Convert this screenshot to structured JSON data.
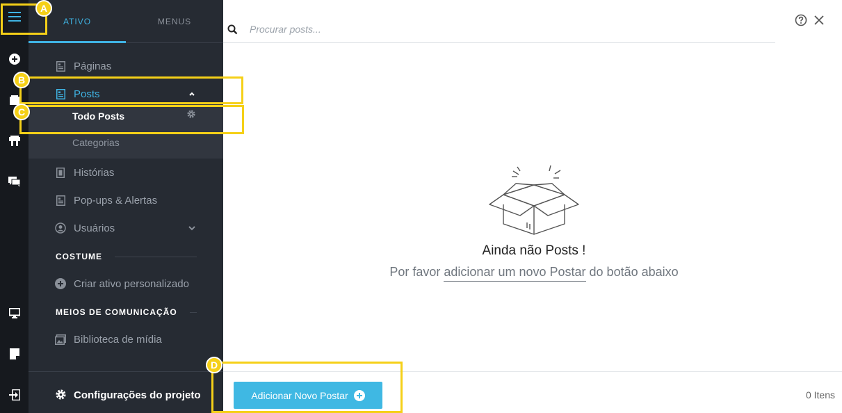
{
  "tabs": {
    "active": "ATIVO",
    "menus": "MENUS"
  },
  "nav": {
    "pages": "Páginas",
    "posts": "Posts",
    "posts_sub": [
      "Todo Posts",
      "Categorias"
    ],
    "stories": "Histórias",
    "popups": "Pop-ups & Alertas",
    "users": "Usuários"
  },
  "sections": {
    "custom": "COSTUME",
    "custom_item": "Criar ativo personalizado",
    "media": "MEIOS DE COMUNICAÇÃO",
    "media_item": "Biblioteca de mídia"
  },
  "settings_label": "Configurações do projeto",
  "search": {
    "placeholder": "Procurar posts..."
  },
  "empty": {
    "title": "Ainda não Posts !",
    "sub_prefix": "Por favor",
    "sub_link": "adicionar um novo Postar",
    "sub_suffix": "do botão abaixo"
  },
  "footer": {
    "add_button": "Adicionar Novo Postar",
    "count": "0 Itens"
  },
  "callouts": [
    "A",
    "B",
    "C",
    "D"
  ],
  "colors": {
    "accent": "#3fb3e3",
    "callout": "#f5d018",
    "sidebar": "#262b33",
    "rail": "#16191e"
  }
}
